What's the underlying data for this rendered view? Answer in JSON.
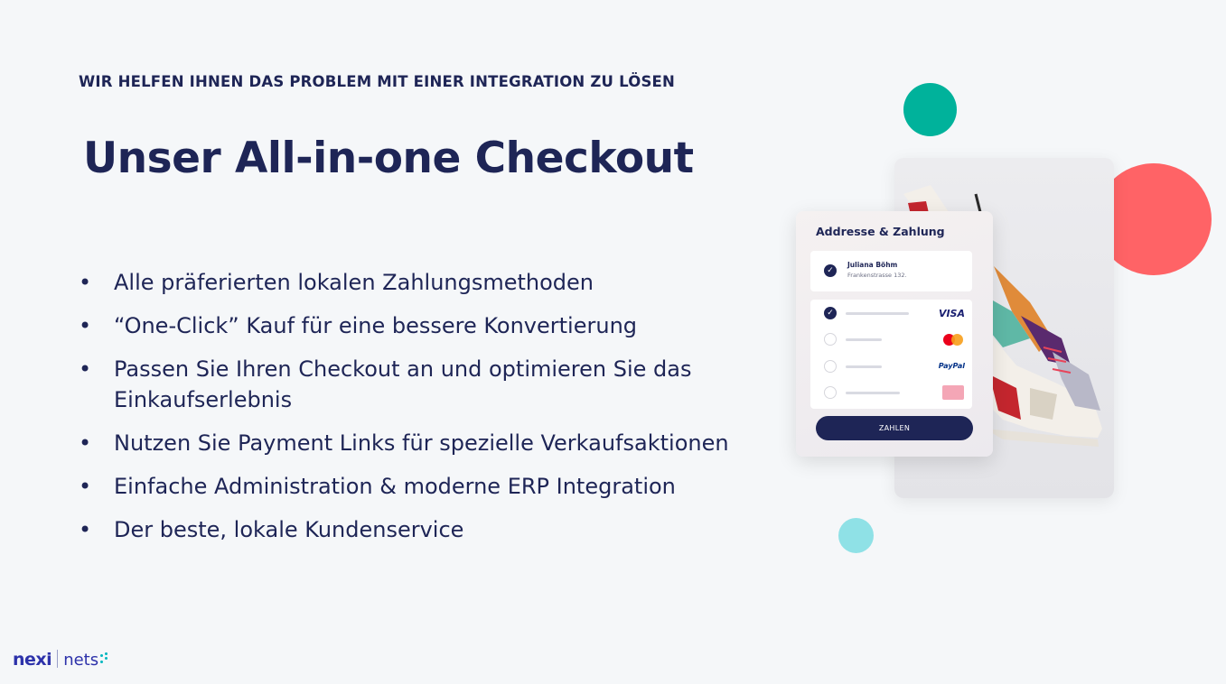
{
  "header": {
    "eyebrow": "WIR HELFEN IHNEN DAS PROBLEM MIT EINER INTEGRATION ZU LÖSEN",
    "title": "Unser All-in-one Checkout"
  },
  "bullets": [
    "Alle präferierten lokalen Zahlungsmethoden",
    "“One-Click” Kauf für eine bessere Konvertierung",
    "Passen Sie Ihren Checkout an und optimieren Sie das Einkaufserlebnis",
    "Nutzen Sie Payment Links für spezielle Verkaufsaktionen",
    "Einfache Administration & moderne ERP Integration",
    "Der beste, lokale Kundenservice"
  ],
  "bullet_symbol": "•",
  "checkout_card": {
    "title": "Addresse & Zahlung",
    "address_name": "Juliana Böhm",
    "address_street": "Frankenstrasse 132.",
    "payment_methods": [
      {
        "label": "VISA",
        "icon": "visa-logo",
        "selected": true
      },
      {
        "label": "",
        "icon": "mastercard-logo",
        "selected": false
      },
      {
        "label": "PayPal",
        "icon": "paypal-logo",
        "selected": false
      },
      {
        "label": "",
        "icon": "klarna-logo",
        "selected": false
      }
    ],
    "pay_button": "ZAHLEN"
  },
  "logo": {
    "brand1": "nexi",
    "brand2": "nets"
  },
  "colors": {
    "primary": "#1e2556",
    "background": "#f5f7f9",
    "green_circle": "#00b29b",
    "red_circle": "#ff6366",
    "teal_circle": "#8fe1e6",
    "logo_blue": "#2d32aa"
  }
}
